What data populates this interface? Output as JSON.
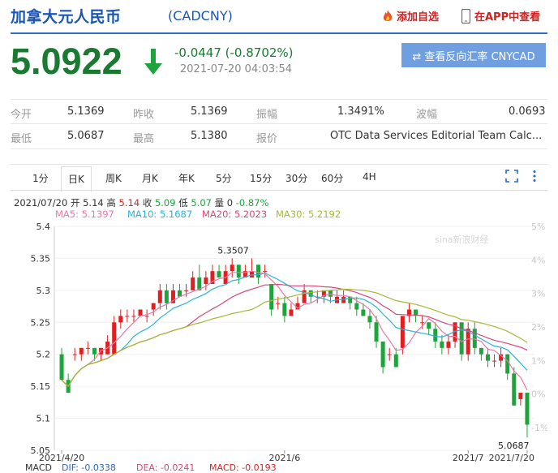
{
  "header": {
    "title": "加拿大元人民币",
    "code": "(CADCNY)",
    "add_favorite": "添加自选",
    "view_app": "在APP中查看"
  },
  "quote": {
    "price": "5.0922",
    "change": "-0.0447 (-0.8702%)",
    "timestamp": "2021-07-20 04:03:54",
    "reverse_button": "⇄ 查看反向汇率 CNYCAD"
  },
  "stats": {
    "open_label": "今开",
    "open": "5.1369",
    "prev_close_label": "昨收",
    "prev_close": "5.1369",
    "amplitude_label": "振幅",
    "amplitude": "1.3491%",
    "volatility_label": "波幅",
    "volatility": "0.0693",
    "low_label": "最低",
    "low": "5.0687",
    "high_label": "最高",
    "high": "5.1380",
    "quote_source_label": "报价",
    "quote_source": "OTC Data Services Editorial Team Calc..."
  },
  "tabs": [
    "1分",
    "日K",
    "周K",
    "月K",
    "年K",
    "5分",
    "15分",
    "30分",
    "60分",
    "4H"
  ],
  "active_tab": "日K",
  "bar_info": {
    "date": "2021/07/20",
    "open_label": "开",
    "open": "5.14",
    "high_label": "高",
    "high": "5.14",
    "close_label": "收",
    "close": "5.09",
    "low_label": "低",
    "low": "5.07",
    "volume_label": "量",
    "volume": "0",
    "change": "-0.87%"
  },
  "ma_legend": {
    "ma5": "MA5: 5.1397",
    "ma10": "MA10: 5.1687",
    "ma20": "MA20: 5.2023",
    "ma30": "MA30: 5.2192"
  },
  "macd_legend": {
    "label": "MACD",
    "dif": "DIF: -0.0338",
    "dea": "DEA: -0.0241",
    "macd": "MACD: -0.0193"
  },
  "watermark": "sina新浪财经",
  "colors": {
    "up": "#e02020",
    "down": "#1fa33c",
    "ma5": "#e87aa8",
    "ma10": "#2ab3d8",
    "ma20": "#d8477a",
    "ma30": "#a7b936"
  },
  "chart_data": {
    "type": "candlestick",
    "y_ticks": [
      "5.4",
      "5.35",
      "5.3",
      "5.25",
      "5.2",
      "5.15",
      "5.1",
      "5.05"
    ],
    "ylim": [
      5.05,
      5.4
    ],
    "pct_ticks": [
      "5%",
      "4%",
      "3%",
      "2%",
      "1%",
      "0%",
      "-1%"
    ],
    "x_ticks": [
      "2021/4/20",
      "2021/6",
      "2021/7",
      "2021/7/20"
    ],
    "annotations": {
      "max": "5.3507",
      "min": "5.0687"
    },
    "candles": [
      [
        5.2,
        5.16,
        5.21,
        5.16
      ],
      [
        5.16,
        5.14,
        5.17,
        5.14
      ],
      [
        5.2,
        5.2,
        5.21,
        5.19
      ],
      [
        5.2,
        5.21,
        5.21,
        5.19
      ],
      [
        5.21,
        5.21,
        5.22,
        5.2
      ],
      [
        5.21,
        5.2,
        5.21,
        5.19
      ],
      [
        5.2,
        5.21,
        5.21,
        5.19
      ],
      [
        5.2,
        5.22,
        5.23,
        5.2
      ],
      [
        5.2,
        5.25,
        5.26,
        5.2
      ],
      [
        5.25,
        5.26,
        5.27,
        5.24
      ],
      [
        5.26,
        5.26,
        5.27,
        5.25
      ],
      [
        5.26,
        5.26,
        5.27,
        5.25
      ],
      [
        5.26,
        5.27,
        5.27,
        5.26
      ],
      [
        5.26,
        5.26,
        5.27,
        5.25
      ],
      [
        5.27,
        5.28,
        5.28,
        5.26
      ],
      [
        5.28,
        5.3,
        5.31,
        5.27
      ],
      [
        5.3,
        5.28,
        5.31,
        5.27
      ],
      [
        5.28,
        5.3,
        5.31,
        5.28
      ],
      [
        5.3,
        5.29,
        5.31,
        5.29
      ],
      [
        5.3,
        5.3,
        5.31,
        5.29
      ],
      [
        5.3,
        5.32,
        5.33,
        5.3
      ],
      [
        5.32,
        5.3,
        5.34,
        5.3
      ],
      [
        5.31,
        5.32,
        5.33,
        5.3
      ],
      [
        5.31,
        5.33,
        5.34,
        5.31
      ],
      [
        5.33,
        5.32,
        5.34,
        5.32
      ],
      [
        5.31,
        5.33,
        5.34,
        5.31
      ],
      [
        5.33,
        5.34,
        5.35,
        5.32
      ],
      [
        5.34,
        5.32,
        5.34,
        5.31
      ],
      [
        5.32,
        5.33,
        5.34,
        5.32
      ],
      [
        5.32,
        5.33,
        5.35,
        5.32
      ],
      [
        5.34,
        5.32,
        5.34,
        5.31
      ],
      [
        5.33,
        5.33,
        5.34,
        5.32
      ],
      [
        5.31,
        5.27,
        5.31,
        5.26
      ],
      [
        5.28,
        5.28,
        5.29,
        5.27
      ],
      [
        5.28,
        5.26,
        5.29,
        5.25
      ],
      [
        5.26,
        5.27,
        5.28,
        5.26
      ],
      [
        5.27,
        5.28,
        5.29,
        5.27
      ],
      [
        5.28,
        5.3,
        5.31,
        5.28
      ],
      [
        5.3,
        5.29,
        5.3,
        5.28
      ],
      [
        5.29,
        5.29,
        5.3,
        5.28
      ],
      [
        5.29,
        5.3,
        5.3,
        5.28
      ],
      [
        5.3,
        5.29,
        5.3,
        5.28
      ],
      [
        5.28,
        5.29,
        5.3,
        5.28
      ],
      [
        5.28,
        5.29,
        5.3,
        5.28
      ],
      [
        5.29,
        5.28,
        5.29,
        5.27
      ],
      [
        5.28,
        5.27,
        5.29,
        5.26
      ],
      [
        5.27,
        5.26,
        5.28,
        5.26
      ],
      [
        5.26,
        5.25,
        5.27,
        5.24
      ],
      [
        5.25,
        5.22,
        5.26,
        5.21
      ],
      [
        5.22,
        5.18,
        5.22,
        5.17
      ],
      [
        5.2,
        5.2,
        5.21,
        5.19
      ],
      [
        5.2,
        5.18,
        5.21,
        5.18
      ],
      [
        5.21,
        5.26,
        5.26,
        5.2
      ],
      [
        5.26,
        5.27,
        5.28,
        5.25
      ],
      [
        5.27,
        5.26,
        5.27,
        5.25
      ],
      [
        5.25,
        5.25,
        5.26,
        5.24
      ],
      [
        5.25,
        5.24,
        5.25,
        5.23
      ],
      [
        5.24,
        5.22,
        5.25,
        5.21
      ],
      [
        5.22,
        5.21,
        5.23,
        5.2
      ],
      [
        5.21,
        5.22,
        5.23,
        5.2
      ],
      [
        5.22,
        5.25,
        5.25,
        5.21
      ],
      [
        5.25,
        5.2,
        5.25,
        5.19
      ],
      [
        5.2,
        5.24,
        5.25,
        5.19
      ],
      [
        5.24,
        5.21,
        5.25,
        5.2
      ],
      [
        5.21,
        5.2,
        5.21,
        5.19
      ],
      [
        5.2,
        5.19,
        5.21,
        5.18
      ],
      [
        5.19,
        5.19,
        5.2,
        5.18
      ],
      [
        5.19,
        5.2,
        5.21,
        5.18
      ],
      [
        5.2,
        5.17,
        5.2,
        5.16
      ],
      [
        5.17,
        5.12,
        5.18,
        5.12
      ],
      [
        5.13,
        5.14,
        5.14,
        5.12
      ],
      [
        5.14,
        5.09,
        5.14,
        5.07
      ]
    ]
  }
}
